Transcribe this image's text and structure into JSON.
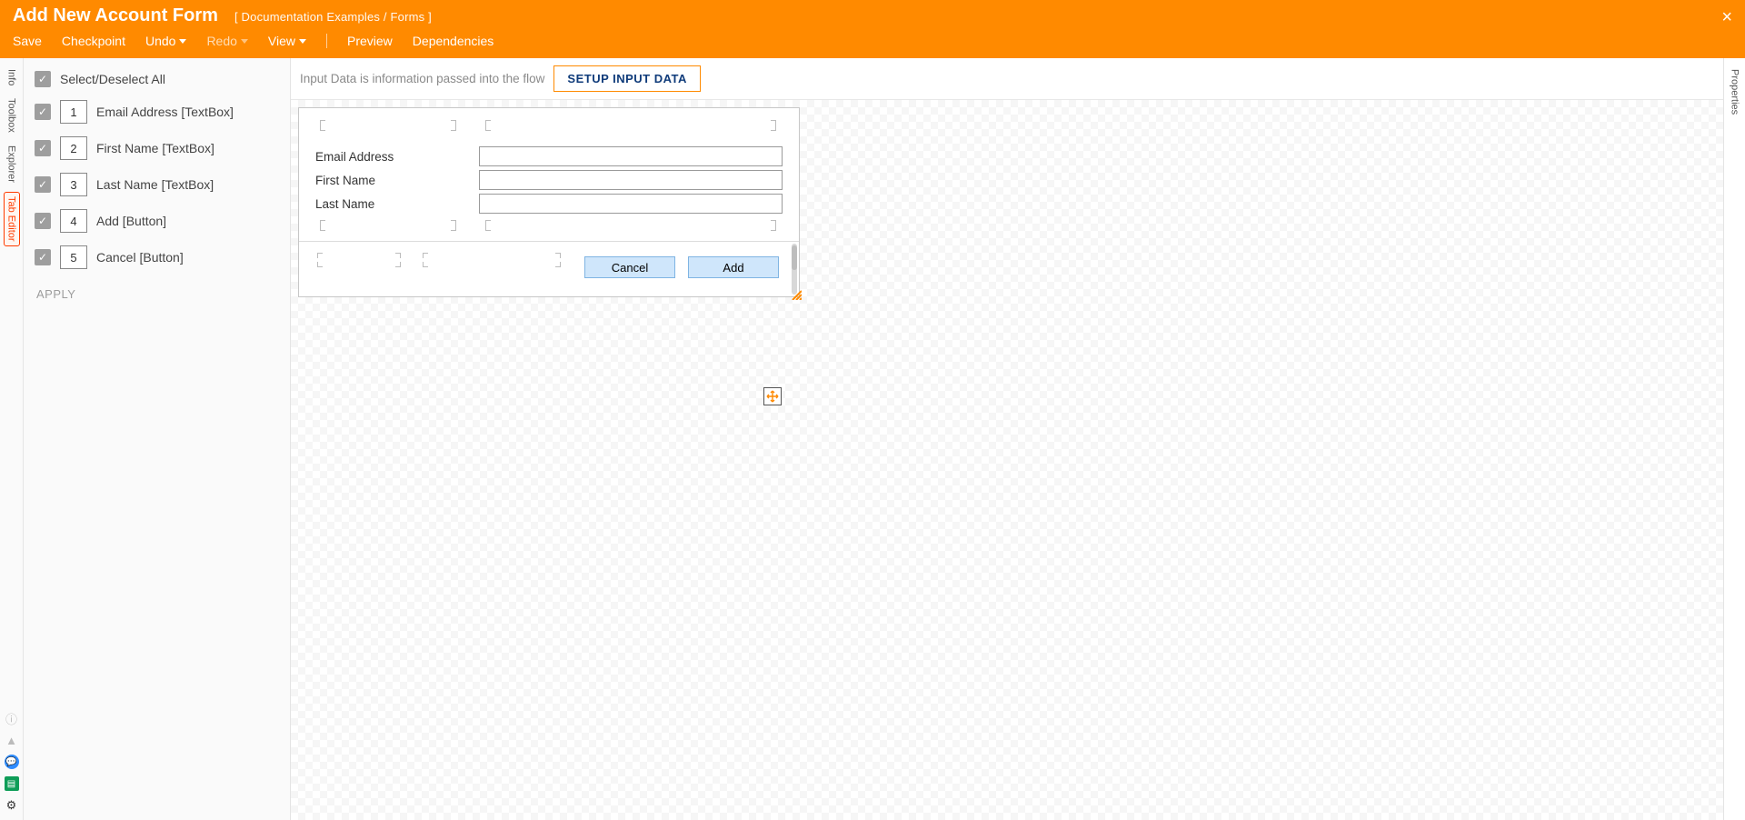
{
  "header": {
    "title": "Add New Account Form",
    "breadcrumb": "[ Documentation Examples / Forms ]",
    "menu": {
      "save": "Save",
      "checkpoint": "Checkpoint",
      "undo": "Undo",
      "redo": "Redo",
      "view": "View",
      "preview": "Preview",
      "dependencies": "Dependencies"
    }
  },
  "leftRail": {
    "tabs": [
      "Info",
      "Toolbox",
      "Explorer",
      "Tab Editor"
    ]
  },
  "sidePanel": {
    "selectAll": "Select/Deselect All",
    "items": [
      {
        "order": "1",
        "label": "Email Address [TextBox]"
      },
      {
        "order": "2",
        "label": "First Name [TextBox]"
      },
      {
        "order": "3",
        "label": "Last Name [TextBox]"
      },
      {
        "order": "4",
        "label": "Add [Button]"
      },
      {
        "order": "5",
        "label": "Cancel [Button]"
      }
    ],
    "apply": "APPLY"
  },
  "inputBar": {
    "text": "Input Data is information passed into the flow",
    "button": "SETUP INPUT DATA"
  },
  "form": {
    "fields": {
      "email": "Email Address",
      "first": "First Name",
      "last": "Last Name"
    },
    "buttons": {
      "cancel": "Cancel",
      "add": "Add"
    }
  },
  "rightRail": {
    "properties": "Properties"
  }
}
